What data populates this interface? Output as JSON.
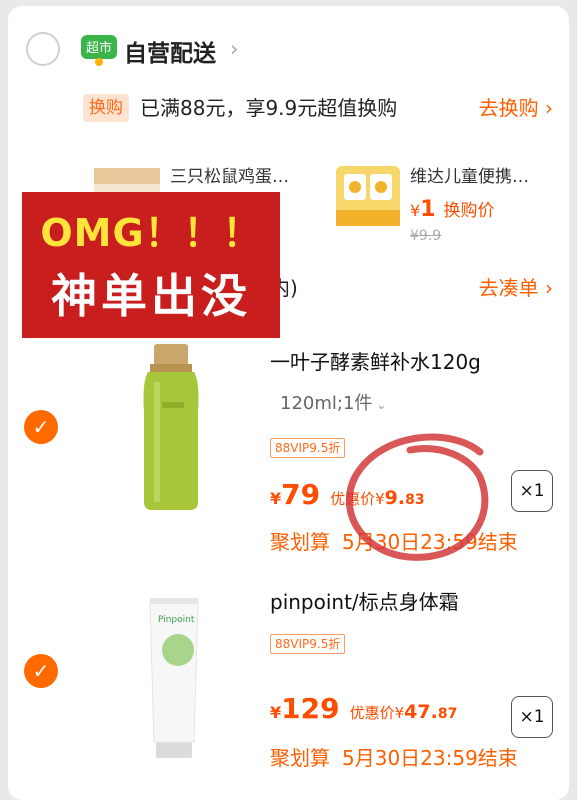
{
  "store": {
    "badge_text": "超市",
    "name": "自营配送",
    "chevron": "›"
  },
  "exchange": {
    "tag": "换购",
    "text": "已满88元，享9.9元超值换购",
    "link": "去换购 ›",
    "offers": [
      {
        "title": "三只松鼠鸡蛋…",
        "image_icon": "snack-box-icon"
      },
      {
        "title": "维达儿童便携…",
        "currency": "¥",
        "price": "1",
        "price_label": "换购价",
        "old_price": "¥9.9",
        "image_icon": "wipes-pack-icon"
      }
    ]
  },
  "coudan": {
    "tail_text": "内)",
    "link": "去凑单 ›"
  },
  "products": [
    {
      "title": "一叶子酵素鲜补水120g",
      "sku": "120ml;1件",
      "sku_arrow": "⌄",
      "vip_tag": "88VIP9.5折",
      "currency": "¥",
      "price": "79",
      "discount_label": "优惠价",
      "discount_currency": "¥",
      "discount_int": "9.",
      "discount_dec": "83",
      "qty": "×1",
      "promo_name": "聚划算",
      "promo_time": "5月30日23:59结束",
      "image_icon": "green-bottle-icon"
    },
    {
      "title": "pinpoint/标点身体霜",
      "vip_tag": "88VIP9.5折",
      "currency": "¥",
      "price": "129",
      "discount_label": "优惠价",
      "discount_currency": "¥",
      "discount_int": "47.",
      "discount_dec": "87",
      "qty": "×1",
      "promo_name": "聚划算",
      "promo_time": "5月30日23:59结束",
      "image_icon": "cream-tube-icon"
    }
  ],
  "sticker": {
    "line1": "OMG！！！",
    "line2": "神单出没"
  },
  "colors": {
    "accent": "#ff5f00",
    "price": "#ff4d00",
    "sticker_bg": "#c81e1e",
    "sticker_yellow": "#ffe53b",
    "annotation": "#d23a3a"
  }
}
